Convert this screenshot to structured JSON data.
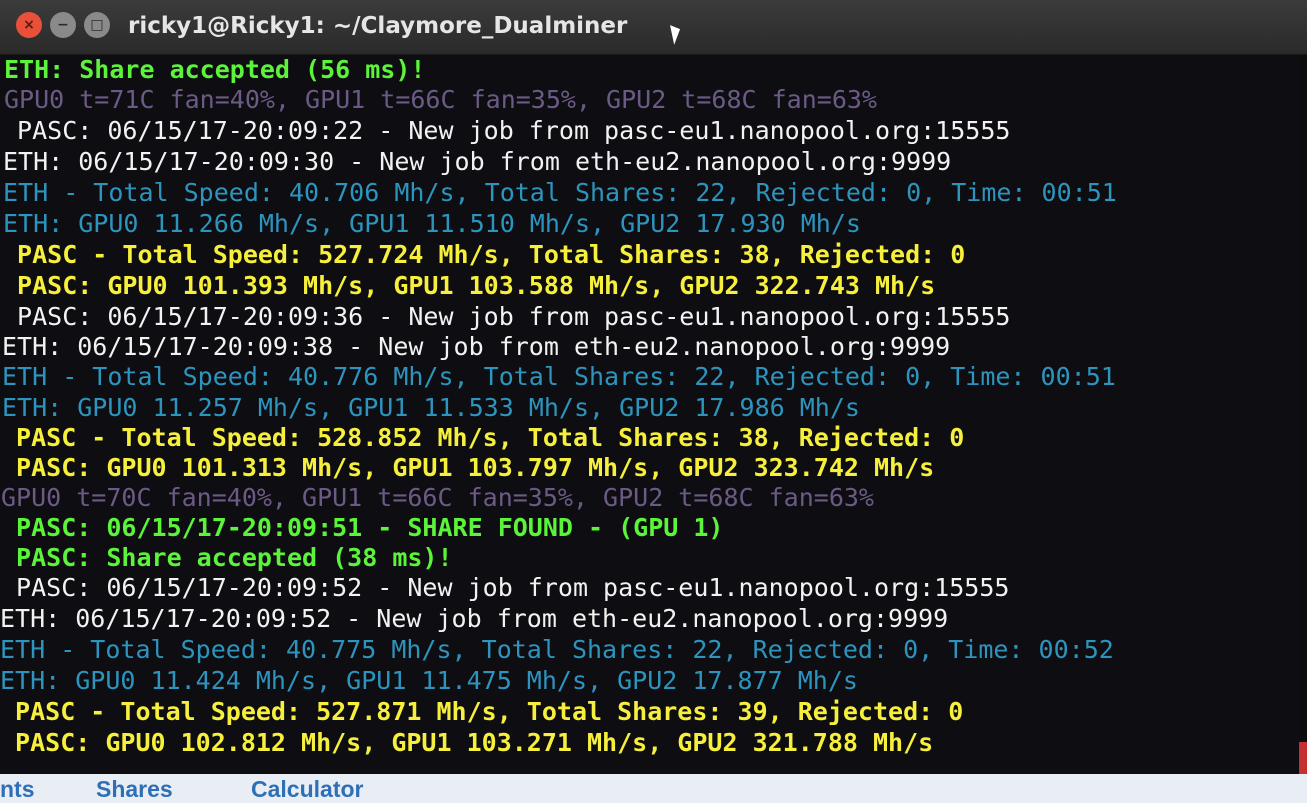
{
  "window": {
    "title": "ricky1@Ricky1: ~/Claymore_Dualminer",
    "buttons": {
      "close": "×",
      "minimize": "−",
      "maximize": "□"
    }
  },
  "terminal": {
    "lines": [
      {
        "text": "ETH: Share accepted (56 ms)!",
        "color": "#5cf43a"
      },
      {
        "text": "GPU0 t=71C fan=40%, GPU1 t=66C fan=35%, GPU2 t=68C fan=63%",
        "color": "#6c5a86"
      },
      {
        "text": " PASC: 06/15/17-20:09:22 - New job from pasc-eu1.nanopool.org:15555",
        "color": "#f2f2f2"
      },
      {
        "text": "ETH: 06/15/17-20:09:30 - New job from eth-eu2.nanopool.org:9999",
        "color": "#f2f2f2"
      },
      {
        "text": "ETH - Total Speed: 40.706 Mh/s, Total Shares: 22, Rejected: 0, Time: 00:51",
        "color": "#2d94bd"
      },
      {
        "text": "ETH: GPU0 11.266 Mh/s, GPU1 11.510 Mh/s, GPU2 17.930 Mh/s",
        "color": "#2d94bd"
      },
      {
        "text": " PASC - Total Speed: 527.724 Mh/s, Total Shares: 38, Rejected: 0",
        "color": "#f6ef3c"
      },
      {
        "text": " PASC: GPU0 101.393 Mh/s, GPU1 103.588 Mh/s, GPU2 322.743 Mh/s",
        "color": "#f6ef3c"
      },
      {
        "text": " PASC: 06/15/17-20:09:36 - New job from pasc-eu1.nanopool.org:15555",
        "color": "#f2f2f2"
      },
      {
        "text": "ETH: 06/15/17-20:09:38 - New job from eth-eu2.nanopool.org:9999",
        "color": "#f2f2f2"
      },
      {
        "text": "ETH - Total Speed: 40.776 Mh/s, Total Shares: 22, Rejected: 0, Time: 00:51",
        "color": "#2d94bd"
      },
      {
        "text": "ETH: GPU0 11.257 Mh/s, GPU1 11.533 Mh/s, GPU2 17.986 Mh/s",
        "color": "#2d94bd"
      },
      {
        "text": " PASC - Total Speed: 528.852 Mh/s, Total Shares: 38, Rejected: 0",
        "color": "#f6ef3c"
      },
      {
        "text": " PASC: GPU0 101.313 Mh/s, GPU1 103.797 Mh/s, GPU2 323.742 Mh/s",
        "color": "#f6ef3c"
      },
      {
        "text": "GPU0 t=70C fan=40%, GPU1 t=66C fan=35%, GPU2 t=68C fan=63%",
        "color": "#6c5a86"
      },
      {
        "text": " PASC: 06/15/17-20:09:51 - SHARE FOUND - (GPU 1)",
        "color": "#5cf43a"
      },
      {
        "text": " PASC: Share accepted (38 ms)!",
        "color": "#5cf43a"
      },
      {
        "text": " PASC: 06/15/17-20:09:52 - New job from pasc-eu1.nanopool.org:15555",
        "color": "#f2f2f2"
      },
      {
        "text": "ETH: 06/15/17-20:09:52 - New job from eth-eu2.nanopool.org:9999",
        "color": "#f2f2f2"
      },
      {
        "text": "ETH - Total Speed: 40.775 Mh/s, Total Shares: 22, Rejected: 0, Time: 00:52",
        "color": "#2d94bd"
      },
      {
        "text": "ETH: GPU0 11.424 Mh/s, GPU1 11.475 Mh/s, GPU2 17.877 Mh/s",
        "color": "#2d94bd"
      },
      {
        "text": " PASC - Total Speed: 527.871 Mh/s, Total Shares: 39, Rejected: 0",
        "color": "#f6ef3c"
      },
      {
        "text": " PASC: GPU0 102.812 Mh/s, GPU1 103.271 Mh/s, GPU2 321.788 Mh/s",
        "color": "#f6ef3c"
      }
    ]
  },
  "background_page": {
    "tabs": [
      "nts",
      "Shares",
      "Calculator"
    ]
  }
}
